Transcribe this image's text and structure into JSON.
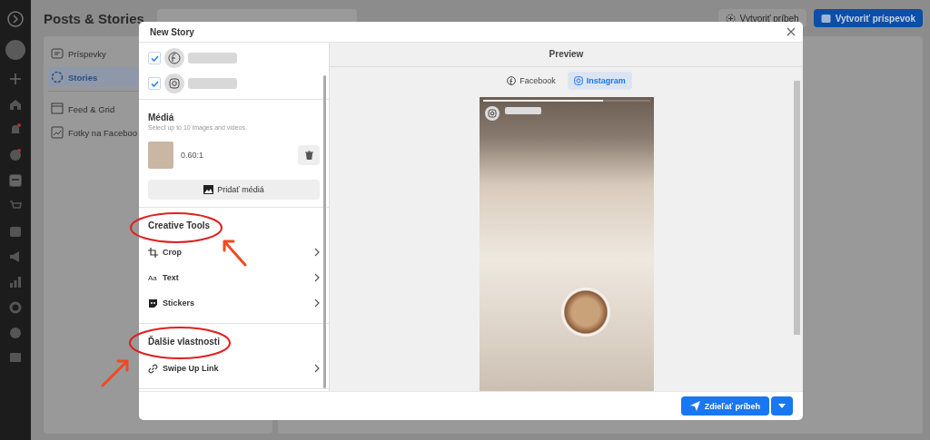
{
  "page": {
    "title": "Posts & Stories",
    "buttons": [
      {
        "label": "Vytvoriť príbeh",
        "kind": "secondary"
      },
      {
        "label": "Vytvoriť príspevok",
        "kind": "primary"
      }
    ]
  },
  "sidebar": {
    "items": [
      {
        "label": "Príspevky",
        "selected": false
      },
      {
        "label": "Stories",
        "selected": true
      },
      {
        "label": "Feed & Grid",
        "selected": false
      },
      {
        "label": "Fotky na Faceboo",
        "selected": false
      }
    ]
  },
  "dialog": {
    "title": "New Story",
    "accounts": [
      {
        "checked": true
      },
      {
        "checked": true
      }
    ],
    "media": {
      "title": "Médiá",
      "hint": "Select up to 10 images and videos.",
      "items": [
        {
          "ratio": "0.60:1"
        }
      ],
      "add_button": "Pridať médiá"
    },
    "sections": [
      {
        "title": "Creative Tools",
        "items": [
          {
            "label": "Crop"
          },
          {
            "label": "Text",
            "glyph": "Aa"
          },
          {
            "label": "Stickers"
          }
        ]
      },
      {
        "title": "Ďalšie vlastnosti",
        "items": [
          {
            "label": "Swipe Up Link"
          }
        ]
      }
    ],
    "preview": {
      "title": "Preview",
      "progress": {
        "level": 0.72
      },
      "tabs": [
        {
          "label": "Facebook",
          "selected": false
        },
        {
          "label": "Instagram",
          "selected": true
        }
      ]
    },
    "share_button": "Zdieľať príbeh"
  }
}
